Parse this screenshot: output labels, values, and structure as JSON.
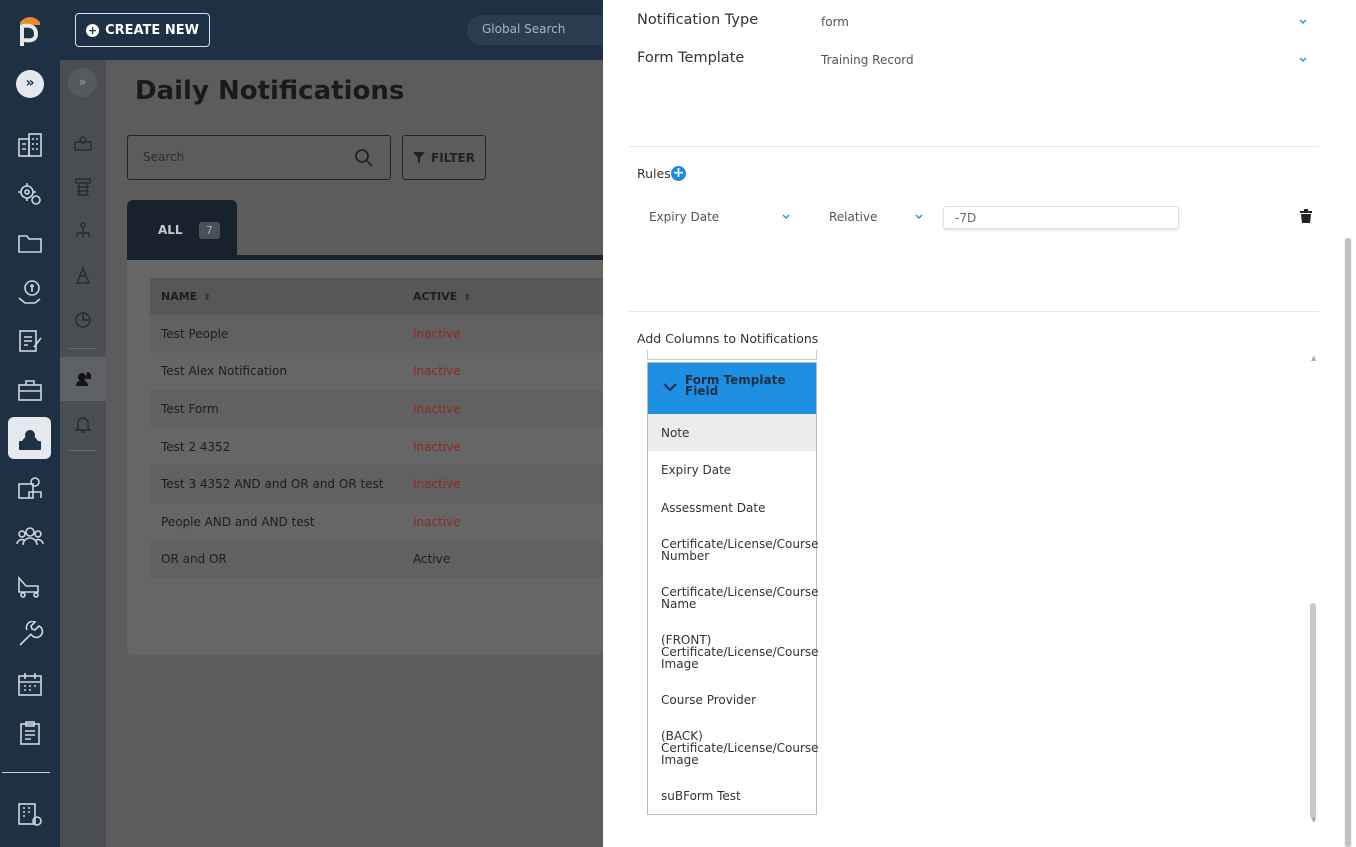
{
  "topbar": {
    "create_new": "CREATE NEW",
    "global_search_placeholder": "Global Search"
  },
  "page": {
    "title": "Daily Notifications",
    "search_placeholder": "Search",
    "filter_label": "FILTER"
  },
  "tabs": {
    "all_label": "ALL",
    "all_count": "7"
  },
  "table": {
    "headers": {
      "name": "NAME",
      "active": "ACTIVE"
    },
    "rows": [
      {
        "name": "Test People",
        "active": "Inactive"
      },
      {
        "name": "Test Alex Notification",
        "active": "Inactive"
      },
      {
        "name": "Test Form",
        "active": "Inactive"
      },
      {
        "name": "Test 2 4352",
        "active": "Inactive"
      },
      {
        "name": "Test 3 4352 AND and OR and OR test",
        "active": "Inactive"
      },
      {
        "name": "People AND and AND test",
        "active": "Inactive"
      },
      {
        "name": "OR and OR",
        "active": "Active"
      }
    ]
  },
  "panel": {
    "notification_type_label": "Notification Type",
    "notification_type_value": "form",
    "form_template_label": "Form Template",
    "form_template_value": "Training Record",
    "rules_label": "Rules",
    "rule": {
      "field": "Expiry Date",
      "mode": "Relative",
      "value": "-7D"
    },
    "add_columns_label": "Add Columns to Notifications",
    "dropdown": {
      "header": "Form Template Field",
      "items": [
        "Note",
        "Expiry Date",
        "Assessment Date",
        "Certificate/License/Course Number",
        "Certificate/License/Course Name",
        "(FRONT) Certificate/License/Course Image",
        "Course Provider",
        "(BACK) Certificate/License/Course Image",
        "suBForm Test"
      ]
    }
  },
  "colors": {
    "accent": "#1e8fe2",
    "navy": "#1e3044",
    "inactive": "#c0392b",
    "logo_orange": "#e8892b"
  }
}
